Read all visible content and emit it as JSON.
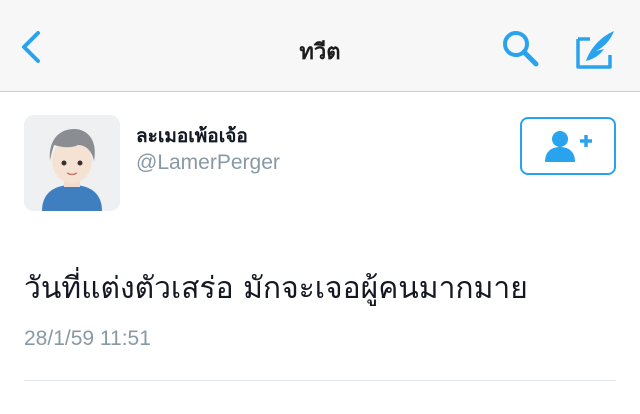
{
  "nav": {
    "title": "ทวีต",
    "back_icon": "chevron-left-icon",
    "search_icon": "search-icon",
    "compose_icon": "compose-icon"
  },
  "tweet": {
    "display_name": "ละเมอเพ้อเจ้อ",
    "username": "@LamerPerger",
    "text": "วันที่แต่งตัวเสร่อ มักจะเจอผู้คนมากมาย",
    "timestamp": "28/1/59 11:51",
    "follow_icon": "add-user-icon"
  },
  "colors": {
    "accent": "#2aa3ef",
    "secondary_text": "#8899a6",
    "primary_text": "#141823",
    "nav_background": "#f7f7f8"
  }
}
